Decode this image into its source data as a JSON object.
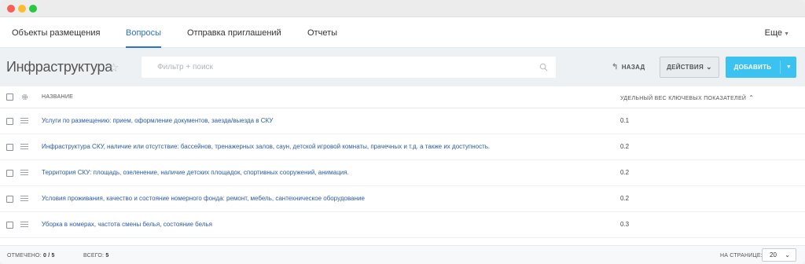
{
  "tabs": [
    {
      "label": "Объекты размещения",
      "active": false
    },
    {
      "label": "Вопросы",
      "active": true
    },
    {
      "label": "Отправка приглашений",
      "active": false
    },
    {
      "label": "Отчеты",
      "active": false
    }
  ],
  "more_label": "Еще",
  "page_title": "Инфраструктура",
  "search": {
    "placeholder": "Фильтр + поиск",
    "value": ""
  },
  "back_label": "НАЗАД",
  "actions_label": "ДЕЙСТВИЯ",
  "add_label": "ДОБАВИТЬ",
  "table": {
    "columns": {
      "name": "НАЗВАНИЕ",
      "weight": "УДЕЛЬНЫЙ ВЕС КЛЮЧЕВЫХ ПОКАЗАТЕЛЕЙ"
    },
    "sort": "ascending",
    "rows": [
      {
        "name": "Услуги по размещению: прием, оформление документов, заезда/выезда в СКУ",
        "weight": "0.1"
      },
      {
        "name": "Инфраструктура СКУ, наличие или отсутствие: бассейнов, тренажерных залов, саун, детской игровой комнаты, прачечных и т.д. а также их доступность.",
        "weight": "0.2"
      },
      {
        "name": "Территория СКУ: площадь, озеленение, наличие детских площадок, спортивных сооружений, анимация.",
        "weight": "0.2"
      },
      {
        "name": "Условия проживания, качество и состояние номерного фонда: ремонт, мебель, сантехническое оборудование",
        "weight": "0.2"
      },
      {
        "name": "Уборка в номерах, частота смены белья, состояние белья",
        "weight": "0.3"
      }
    ]
  },
  "footer": {
    "selected_label": "ОТМЕЧЕНО:",
    "selected_value": "0 / 5",
    "total_label": "ВСЕГО:",
    "total_value": "5",
    "per_page_label": "НА СТРАНИЦЕ:",
    "per_page_value": "20"
  },
  "colors": {
    "accent": "#2b73c9",
    "add_button": "#3bc2f1",
    "link": "#2b5aa6",
    "toolbar_bg": "#eef1f4"
  },
  "icons": [
    "star-icon",
    "search-icon",
    "back-arrow-icon",
    "chevron-down-icon",
    "gear-icon",
    "drag-handle-icon"
  ]
}
